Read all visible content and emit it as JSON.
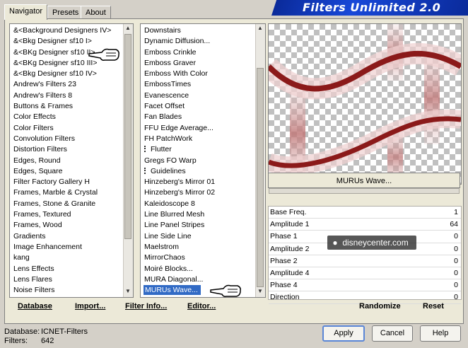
{
  "tabs": [
    "Navigator",
    "Presets",
    "About"
  ],
  "title": "Filters Unlimited 2.0",
  "categories": [
    "&<Background Designers IV>",
    "&<Bkg Designer sf10 I>",
    "&<BKg Designer sf10 II>",
    "&<BKg Designer sf10 III>",
    "&<Bkg Designer sf10 IV>",
    "Andrew's Filters 23",
    "Andrew's Filters 8",
    "Buttons & Frames",
    "Color Effects",
    "Color Filters",
    "Convolution Filters",
    "Distortion Filters",
    "Edges, Round",
    "Edges, Square",
    "Filter Factory Gallery H",
    "Frames, Marble & Crystal",
    "Frames, Stone & Granite",
    "Frames, Textured",
    "Frames, Wood",
    "Gradients",
    "Image Enhancement",
    "kang",
    "Lens Effects",
    "Lens Flares",
    "Noise Filters"
  ],
  "filters": [
    {
      "label": "Downstairs",
      "marker": false
    },
    {
      "label": "Dynamic Diffusion...",
      "marker": false
    },
    {
      "label": "Emboss Crinkle",
      "marker": false
    },
    {
      "label": "Emboss Graver",
      "marker": false
    },
    {
      "label": "Emboss With Color",
      "marker": false
    },
    {
      "label": "EmbossTimes",
      "marker": false
    },
    {
      "label": "Evanescence",
      "marker": false
    },
    {
      "label": "Facet Offset",
      "marker": false
    },
    {
      "label": "Fan Blades",
      "marker": false
    },
    {
      "label": "FFU Edge Average...",
      "marker": false
    },
    {
      "label": "FH PatchWork",
      "marker": false
    },
    {
      "label": "Flutter",
      "marker": true
    },
    {
      "label": "Gregs FO Warp",
      "marker": false
    },
    {
      "label": "Guidelines",
      "marker": true
    },
    {
      "label": "Hinzeberg's Mirror 01",
      "marker": false
    },
    {
      "label": "Hinzeberg's Mirror 02",
      "marker": false
    },
    {
      "label": "Kaleidoscope 8",
      "marker": false
    },
    {
      "label": "Line Blurred Mesh",
      "marker": false
    },
    {
      "label": "Line Panel Stripes",
      "marker": false
    },
    {
      "label": "Line Side Line",
      "marker": false
    },
    {
      "label": "Maelstrom",
      "marker": false
    },
    {
      "label": "MirrorChaos",
      "marker": false
    },
    {
      "label": "Moiré Blocks...",
      "marker": false
    },
    {
      "label": "MURA Diagonal...",
      "marker": false
    },
    {
      "label": "MURUs Wave...",
      "marker": false
    }
  ],
  "selected_filter": "MURUs Wave...",
  "bottom_buttons": {
    "database": "Database",
    "import": "Import...",
    "filter_info": "Filter Info...",
    "editor": "Editor..."
  },
  "filter_name": "MURUs Wave...",
  "params": [
    {
      "label": "Base Freq.",
      "value": "1"
    },
    {
      "label": "Amplitude 1",
      "value": "64"
    },
    {
      "label": "Phase 1",
      "value": "0"
    },
    {
      "label": "Amplitude 2",
      "value": "0"
    },
    {
      "label": "Phase 2",
      "value": "0"
    },
    {
      "label": "Amplitude 4",
      "value": "0"
    },
    {
      "label": "Phase 4",
      "value": "0"
    },
    {
      "label": "Direction",
      "value": "0"
    }
  ],
  "randomize": "Randomize",
  "reset": "Reset",
  "footer": {
    "database_label": "Database:",
    "database_value": "ICNET-Filters",
    "filters_label": "Filters:",
    "filters_value": "642"
  },
  "dialog_buttons": {
    "apply": "Apply",
    "cancel": "Cancel",
    "help": "Help"
  },
  "watermark": "disneycenter.com",
  "colors": {
    "wave": "#8b1a1a",
    "selection": "#316ac5",
    "banner": "#1848d8"
  }
}
